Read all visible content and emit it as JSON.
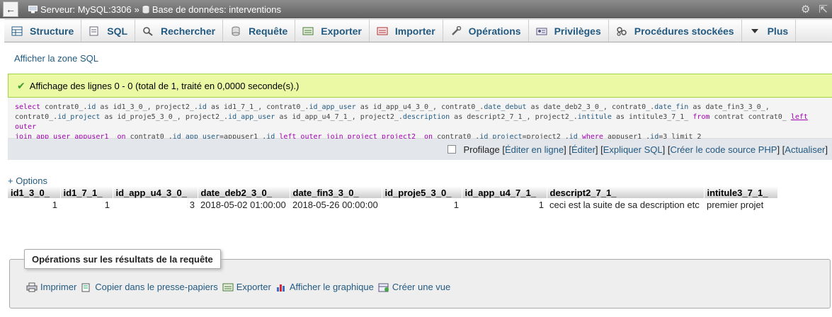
{
  "topbar": {
    "back_symbol": "←",
    "server_label": "Serveur: MySQL:3306",
    "separator": "»",
    "db_label": "Base de données: interventions"
  },
  "tabs": [
    {
      "label": "Structure",
      "icon": "table-structure-icon"
    },
    {
      "label": "SQL",
      "icon": "sql-icon"
    },
    {
      "label": "Rechercher",
      "icon": "search-icon"
    },
    {
      "label": "Requête",
      "icon": "query-icon"
    },
    {
      "label": "Exporter",
      "icon": "export-icon"
    },
    {
      "label": "Importer",
      "icon": "import-icon"
    },
    {
      "label": "Opérations",
      "icon": "wrench-icon"
    },
    {
      "label": "Privilèges",
      "icon": "privileges-icon"
    },
    {
      "label": "Procédures stockées",
      "icon": "stored-procedures-icon"
    },
    {
      "label": "Plus",
      "icon": "caret-down-icon"
    }
  ],
  "show_sql_link": "Afficher la zone SQL",
  "success_message": "Affichage des lignes 0 - 0 (total de 1, traité en 0,0000 seconde(s).)",
  "sql_text": {
    "t1": "select",
    "t2": " contrat0_.",
    "t3": "id",
    "t4": " as id1_3_0_, project2_.",
    "t5": "id",
    "t6": " as id1_7_1_, contrat0_.",
    "t7": "id_app_user",
    "t8": " as id_app_u4_3_0_, contrat0_.",
    "t9": "date_debut",
    "t10": " as date_deb2_3_0_, contrat0_.",
    "t11": "date_fin",
    "t12": " as date_fin3_3_0_,",
    "t13": "contrat0_.",
    "t14": "id_project",
    "t15": " as id_proje5_3_0_, project2_.",
    "t16": "id_app_user",
    "t17": " as id_app_u4_7_1_, project2_.",
    "t18": "description",
    "t19": " as descript2_7_1_, project2_.",
    "t20": "intitule",
    "t21": " as intitule3_7_1_ ",
    "t22": "from",
    "t23": " contrat contrat0_ ",
    "t24": "left",
    "t25": " outer",
    "t26": "join app_user appuser1_ ",
    "t27": "on",
    "t28": " contrat0_.",
    "t29": "id_app_user",
    "t30": "=appuser1_.",
    "t31": "id",
    "t32": " left",
    "t33": " outer join project project2_ ",
    "t34": "on",
    "t35": " contrat0_.",
    "t36": "id_project",
    "t37": "=project2_.",
    "t38": "id",
    "t39": " where",
    "t40": " appuser1_.",
    "t41": "id",
    "t42": "=3 limit 2"
  },
  "profiling": {
    "label": "Profilage",
    "links": [
      "Éditer en ligne",
      "Éditer",
      "Expliquer SQL",
      "Créer le code source PHP",
      "Actualiser"
    ]
  },
  "options_link": "+ Options",
  "results": {
    "columns": [
      "id1_3_0_",
      "id1_7_1_",
      "id_app_u4_3_0_",
      "date_deb2_3_0_",
      "date_fin3_3_0_",
      "id_proje5_3_0_",
      "id_app_u4_7_1_",
      "descript2_7_1_",
      "intitule3_7_1_"
    ],
    "rows": [
      [
        "1",
        "1",
        "3",
        "2018-05-02 01:00:00",
        "2018-05-26 00:00:00",
        "1",
        "1",
        "ceci est la suite de sa description etc",
        "premier projet"
      ]
    ]
  },
  "operations": {
    "legend": "Opérations sur les résultats de la requête",
    "items": [
      {
        "label": "Imprimer",
        "icon": "printer-icon"
      },
      {
        "label": "Copier dans le presse-papiers",
        "icon": "clipboard-icon"
      },
      {
        "label": "Exporter",
        "icon": "export-icon"
      },
      {
        "label": "Afficher le graphique",
        "icon": "chart-icon"
      },
      {
        "label": "Créer une vue",
        "icon": "create-view-icon"
      }
    ]
  },
  "colors": {
    "link": "#235a81",
    "success_bg": "#ebf8a4",
    "success_border": "#a2d246",
    "sql_keyword": "#a000b0"
  }
}
